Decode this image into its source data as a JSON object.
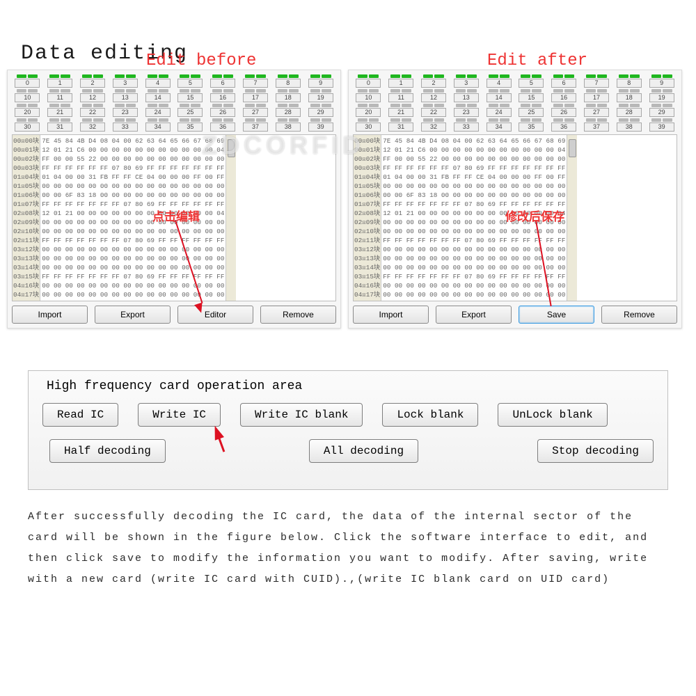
{
  "title": "Data editing",
  "watermark": "ZDCORFID",
  "labels": {
    "before": "Edit before",
    "after": "Edit after"
  },
  "sectors": {
    "numbers": [
      "0",
      "1",
      "2",
      "3",
      "4",
      "5",
      "6",
      "7",
      "8",
      "9",
      "10",
      "11",
      "12",
      "13",
      "14",
      "15",
      "16",
      "17",
      "18",
      "19",
      "20",
      "21",
      "22",
      "23",
      "24",
      "25",
      "26",
      "27",
      "28",
      "29",
      "30",
      "31",
      "32",
      "33",
      "34",
      "35",
      "36",
      "37",
      "38",
      "39"
    ]
  },
  "before": {
    "rowLabels": "00☒00块\n00☒01块\n00☒02块\n00☒03块\n01☒04块\n01☒05块\n01☒06块\n01☒07块\n02☒08块\n02☒09块\n02☒10块\n02☒11块\n03☒12块\n03☒13块\n03☒14块\n03☒15块\n04☒16块\n04☒17块",
    "hex": "7E 45 84 4B D4 08 04 00 62 63 64 65 66 67 68 69\n12 01 21 C6 00 00 00 00 00 00 00 00 00 00 00 04\nFF 00 00 55 22 00 00 00 00 00 00 00 00 00 00 00\nFF FF FF FF FF FF 07 80 69 FF FF FF FF FF FF FF\n01 04 00 00 31 FB FF FF CE 04 00 00 00 FF 00 FF\n00 00 00 00 00 00 00 00 00 00 00 00 00 00 00 00\n00 00 6F 83 18 00 00 00 00 00 00 00 00 00 00 00\nFF FF FF FF FF FF FF 07 80 69 FF FF FF FF FF FF\n12 01 21 00 00 00 00 00 00 00 00 00 00 00 00 04\n00 00 00 00 00 00 00 00 00 00 00 00 00 00 00 00\n00 00 00 00 00 00 00 00 00 00 00 00 00 00 00 00\nFF FF FF FF FF FF FF 07 80 69 FF FF FF FF FF FF\n00 00 00 00 00 00 00 00 00 00 00 00 00 00 00 00\n00 00 00 00 00 00 00 00 00 00 00 00 00 00 00 00\n00 00 00 00 00 00 00 00 00 00 00 00 00 00 00 00\nFF FF FF FF FF FF FF 07 80 69 FF FF FF FF FF FF\n00 00 00 00 00 00 00 00 00 00 00 00 00 00 00 00\n00 00 00 00 00 00 00 00 00 00 00 00 00 00 00 00",
    "buttons": {
      "import": "Import",
      "export": "Export",
      "editor": "Editor",
      "remove": "Remove"
    },
    "annotation": "点击编辑"
  },
  "after": {
    "rowLabels": "00☒00块\n00☒01块\n00☒02块\n00☒03块\n01☒04块\n01☒05块\n01☒06块\n01☒07块\n02☒08块\n02☒09块\n02☒10块\n02☒11块\n03☒12块\n03☒13块\n03☒14块\n03☒15块\n04☒16块\n04☒17块",
    "hex": "7E 45 84 4B D4 08 04 00 62 63 64 65 66 67 68 69\n12 01 21 C6 00 00 00 00 00 00 00 00 00 00 00 04\nFF 00 00 55 22 00 00 00 00 00 00 00 00 00 00 00\nFF FF FF FF FF FF 07 80 69 FF FF FF FF FF FF FF\n01 04 00 00 31 FB FF FF CE 04 00 00 00 FF 00 FF\n00 00 00 00 00 00 00 00 00 00 00 00 00 00 00 00\n00 00 6F 83 18 00 00 00 00 00 00 00 00 00 00 00\nFF FF FF FF FF FF FF 07 80 69 FF FF FF FF FF FF\n12 01 21 00 00 00 00 00 00 00 00 00 00 00 00 04\n00 00 00 00 00 00 00 00 00 00 00 00 00 00 00 00\n00 00 00 00 00 00 00 00 00 00 00 00 00 00 00 00\nFF FF FF FF FF FF FF 07 80 69 FF FF FF FF FF FF\n00 00 00 00 00 00 00 00 00 00 00 00 00 00 00 00\n00 00 00 00 00 00 00 00 00 00 00 00 00 00 00 00\n00 00 00 00 00 00 00 00 00 00 00 00 00 00 00 00\nFF FF FF FF FF FF FF 07 80 69 FF FF FF FF FF FF\n00 00 00 00 00 00 00 00 00 00 00 00 00 00 00 00\n00 00 00 00 00 00 00 00 00 00 00 00 00 00 00 00",
    "buttons": {
      "import": "Import",
      "export": "Export",
      "save": "Save",
      "remove": "Remove"
    },
    "annotation": "修改后保存"
  },
  "oparea": {
    "title": "High frequency card operation area",
    "row1": {
      "read": "Read IC",
      "write": "Write IC",
      "writeblank": "Write IC blank",
      "lock": "Lock blank",
      "unlock": "UnLock blank"
    },
    "row2": {
      "half": "Half decoding",
      "all": "All decoding",
      "stop": "Stop decoding"
    }
  },
  "instructions": "After successfully decoding the IC card, the data of the internal sector of the card will be shown in the figure below. Click the software interface to edit, and then click save to modify the information you want to modify. After saving, write with a new card (write IC card with CUID).,(write IC blank card on UID card)"
}
